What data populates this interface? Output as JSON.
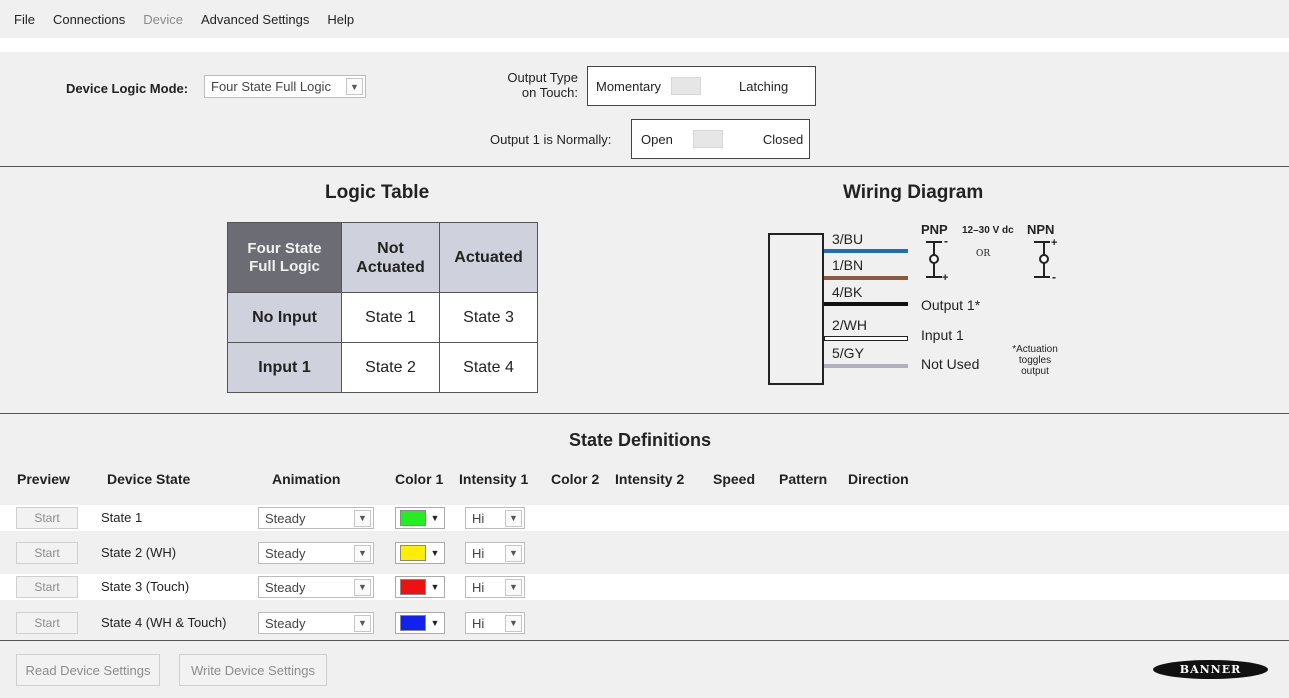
{
  "menu": {
    "file": "File",
    "connections": "Connections",
    "device": "Device",
    "advanced": "Advanced Settings",
    "help": "Help"
  },
  "settings": {
    "logic_mode_label": "Device Logic Mode:",
    "logic_mode_value": "Four State Full Logic",
    "output_type_label_1": "Output Type",
    "output_type_label_2": "on Touch:",
    "output_type_left": "Momentary",
    "output_type_right": "Latching",
    "normally_label": "Output 1 is Normally:",
    "normally_left": "Open",
    "normally_right": "Closed"
  },
  "logic_table": {
    "title": "Logic Table",
    "corner_1": "Four State",
    "corner_2": "Full Logic",
    "col1_1": "Not",
    "col1_2": "Actuated",
    "col2": "Actuated",
    "rows": [
      {
        "label": "No Input",
        "c1": "State 1",
        "c2": "State 3"
      },
      {
        "label": "Input 1",
        "c1": "State 2",
        "c2": "State 4"
      }
    ]
  },
  "wiring": {
    "title": "Wiring Diagram",
    "wires": [
      {
        "code": "3/BU",
        "color": "#1f6fb5"
      },
      {
        "code": "1/BN",
        "color": "#8a5a3c"
      },
      {
        "code": "4/BK",
        "color": "#111111"
      },
      {
        "code": "2/WH",
        "color": "#ffffff"
      },
      {
        "code": "5/GY",
        "color": "#b0b0b8"
      }
    ],
    "pnp": "PNP",
    "voltage": "12–30 V dc",
    "npn": "NPN",
    "or": "OR",
    "output1": "Output 1*",
    "input1": "Input 1",
    "not_used": "Not Used",
    "note_1": "*Actuation",
    "note_2": "toggles",
    "note_3": "output"
  },
  "states": {
    "title": "State Definitions",
    "headers": {
      "preview": "Preview",
      "device_state": "Device State",
      "animation": "Animation",
      "color1": "Color 1",
      "intensity1": "Intensity 1",
      "color2": "Color 2",
      "intensity2": "Intensity 2",
      "speed": "Speed",
      "pattern": "Pattern",
      "direction": "Direction"
    },
    "rows": [
      {
        "start": "Start",
        "name": "State 1",
        "animation": "Steady",
        "color": "#22ee22",
        "intensity": "Hi"
      },
      {
        "start": "Start",
        "name": "State 2 (WH)",
        "animation": "Steady",
        "color": "#ffee00",
        "intensity": "Hi"
      },
      {
        "start": "Start",
        "name": "State 3 (Touch)",
        "animation": "Steady",
        "color": "#ee1111",
        "intensity": "Hi"
      },
      {
        "start": "Start",
        "name": "State 4 (WH & Touch)",
        "animation": "Steady",
        "color": "#1122ee",
        "intensity": "Hi"
      }
    ]
  },
  "footer": {
    "read": "Read Device Settings",
    "write": "Write Device Settings",
    "logo": "BANNER"
  }
}
